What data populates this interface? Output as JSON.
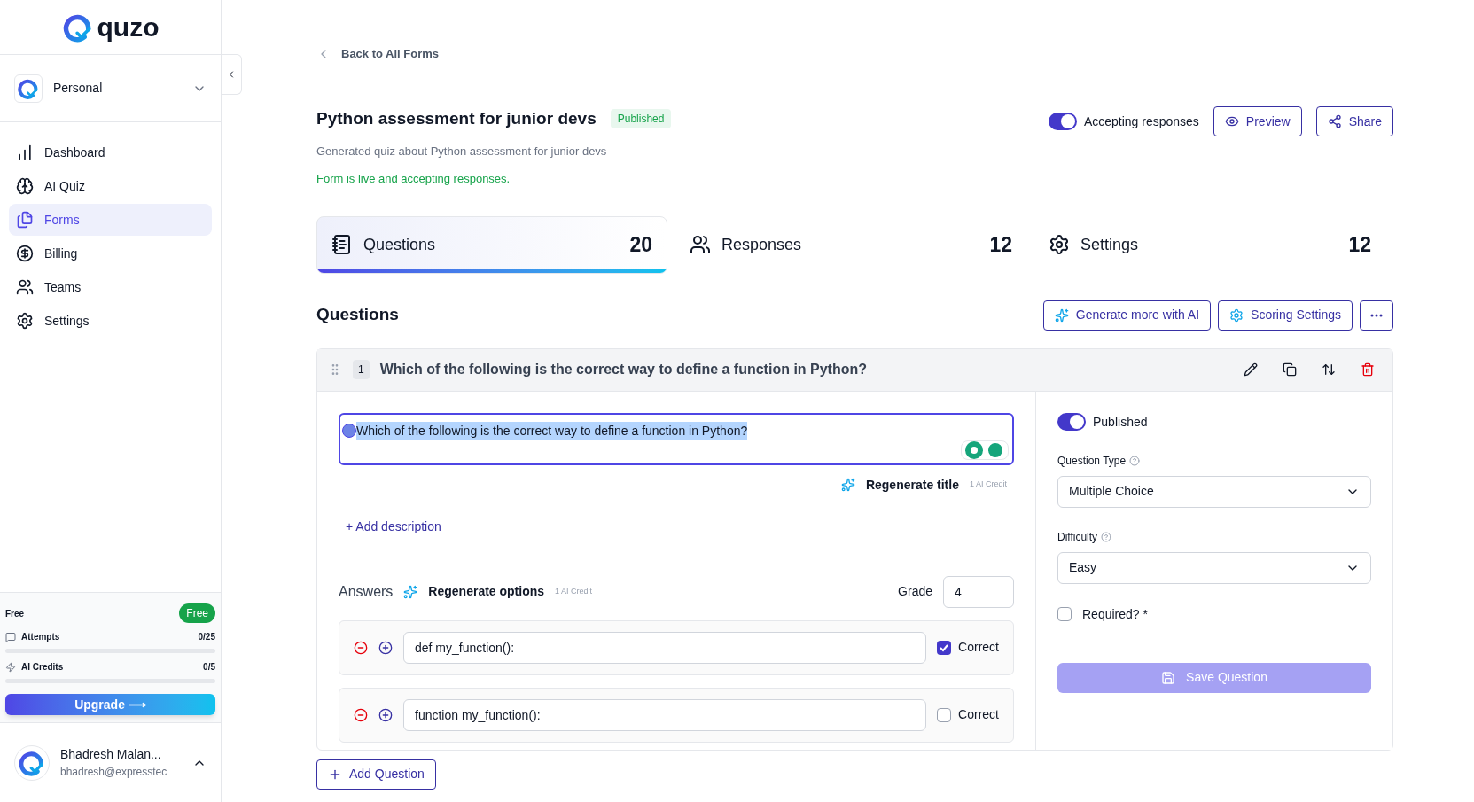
{
  "brand": {
    "name": "quzo"
  },
  "workspace": {
    "name": "Personal"
  },
  "sidebar": {
    "items": [
      {
        "label": "Dashboard",
        "selected": false
      },
      {
        "label": "AI Quiz",
        "selected": false
      },
      {
        "label": "Forms",
        "selected": true
      },
      {
        "label": "Billing",
        "selected": false
      },
      {
        "label": "Teams",
        "selected": false
      },
      {
        "label": "Settings",
        "selected": false
      }
    ]
  },
  "plan": {
    "name": "Free",
    "badge": "Free",
    "usage": [
      {
        "label": "Attempts",
        "reading": "0/25",
        "level": 0
      },
      {
        "label": "AI Credits",
        "reading": "0/5",
        "level": 0
      }
    ],
    "upgrade": "Upgrade ⟶"
  },
  "user": {
    "name": "Bhadresh Malan...",
    "email": "bhadresh@expresstec"
  },
  "back_link": "Back to All Forms",
  "form": {
    "title": "Python assessment for junior devs",
    "status": "Published",
    "description": "Generated quiz about Python assessment for junior devs",
    "live_note": "Form is live and accepting responses.",
    "accepting": {
      "label": "Accepting responses",
      "on": true
    },
    "buttons": [
      {
        "label": "Preview"
      },
      {
        "label": "Share"
      }
    ]
  },
  "tabs": [
    {
      "label": "Questions",
      "count": "20",
      "selected": true
    },
    {
      "label": "Responses",
      "count": "12",
      "selected": false
    },
    {
      "label": "Settings",
      "count": "12",
      "selected": false
    }
  ],
  "questions_section": {
    "heading": "Questions",
    "buttons": [
      {
        "label": "Generate more with AI"
      },
      {
        "label": "Scoring Settings"
      }
    ]
  },
  "question": {
    "number": "1",
    "title": "Which of the following is the correct way to define a function in Python?",
    "title_field": "Which of the following is the correct way to define a function in Python?",
    "regenerate_title": "Regenerate title",
    "title_credit": "1 AI Credit",
    "add_description": "+ Add description",
    "answers_label": "Answers",
    "regenerate_options": "Regenerate options",
    "options_credit": "1 AI Credit",
    "grade_label": "Grade",
    "grade": "4",
    "answers": [
      {
        "text": "def my_function():",
        "correct_label": "Correct",
        "checked": true
      },
      {
        "text": "function my_function():",
        "correct_label": "Correct",
        "checked": false
      }
    ],
    "published": {
      "label": "Published",
      "on": true
    },
    "question_type": {
      "label": "Question Type",
      "value": "Multiple Choice"
    },
    "difficulty": {
      "label": "Difficulty",
      "value": "Easy"
    },
    "required": {
      "label": "Required? *",
      "checked": false
    },
    "save": "Save Question"
  },
  "add_question": "Add Question"
}
